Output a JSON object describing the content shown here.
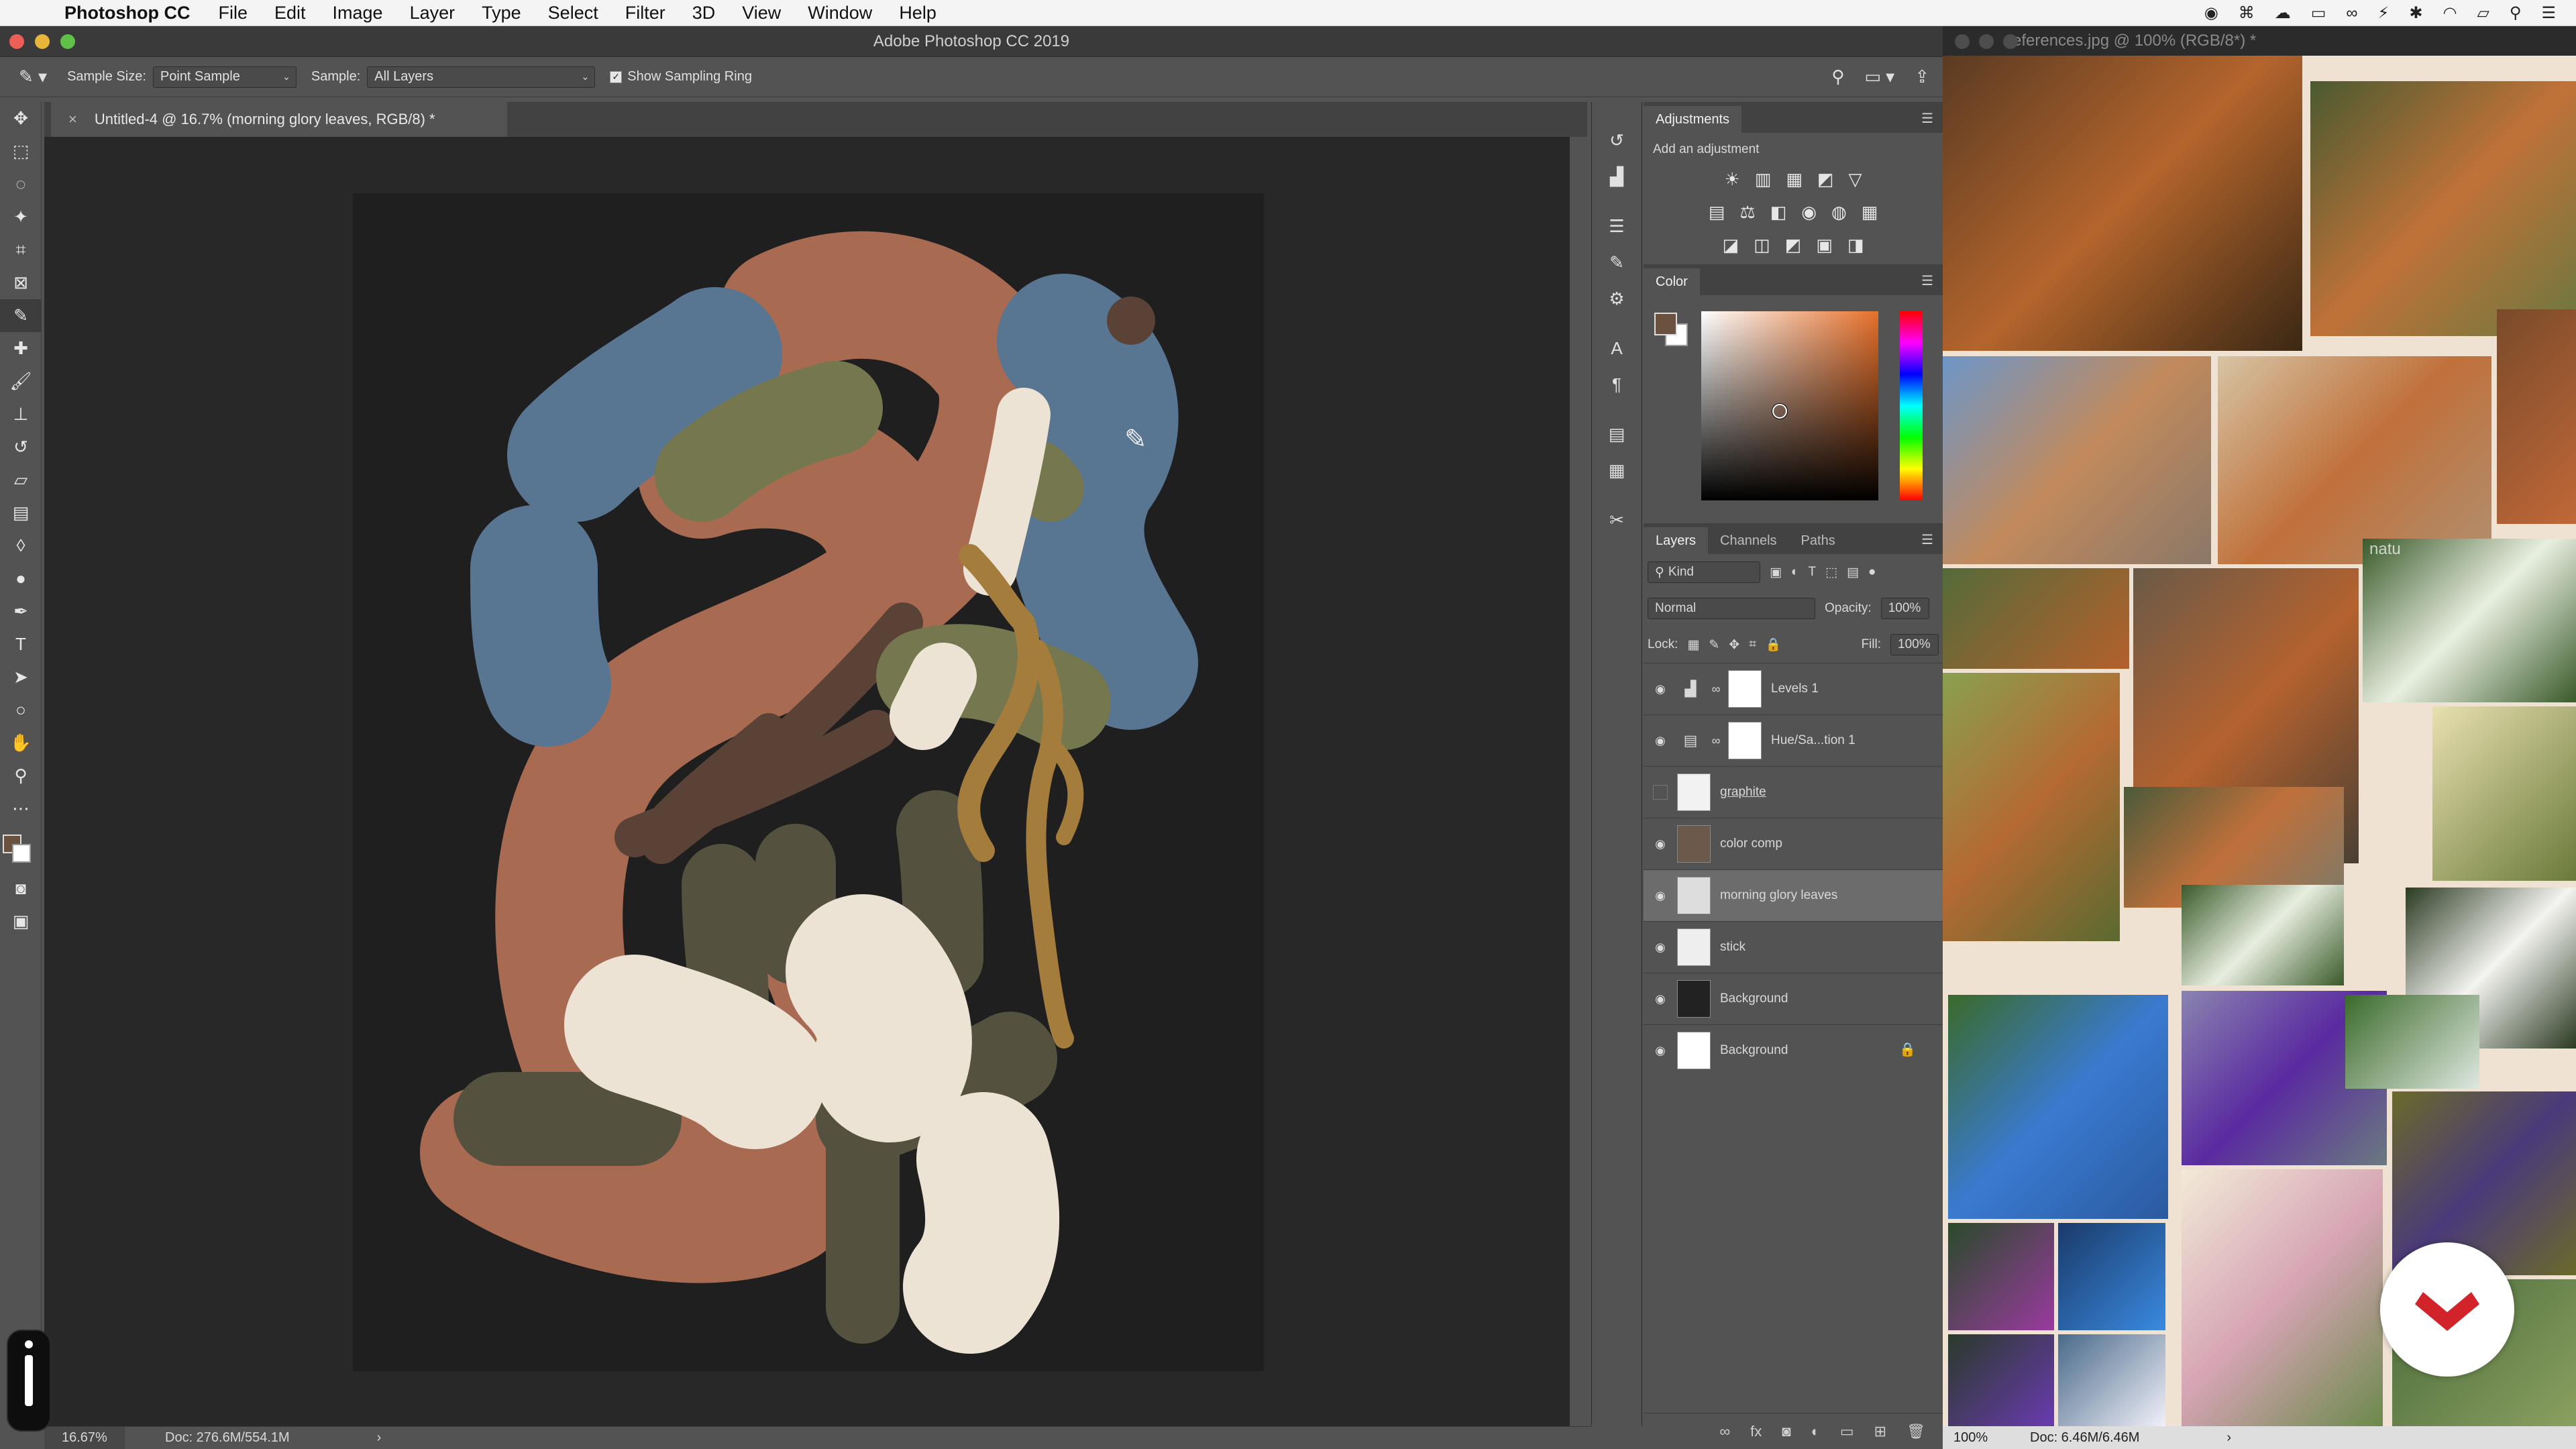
{
  "menubar": {
    "app_name": "Photoshop CC",
    "items": [
      "File",
      "Edit",
      "Image",
      "Layer",
      "Type",
      "Select",
      "Filter",
      "3D",
      "View",
      "Window",
      "Help"
    ]
  },
  "ps_window": {
    "title": "Adobe Photoshop CC 2019"
  },
  "options_bar": {
    "sample_size_label": "Sample Size:",
    "sample_size_value": "Point Sample",
    "sample_label": "Sample:",
    "sample_value": "All Layers",
    "show_ring_label": "Show Sampling Ring",
    "show_ring_checked": true
  },
  "document": {
    "tab_label": "Untitled-4 @ 16.7% (morning glory leaves, RGB/8) *",
    "close_glyph": "×"
  },
  "status_bar": {
    "zoom": "16.67%",
    "doc_size": "Doc: 276.6M/554.1M",
    "arrow": "›"
  },
  "adjustments_panel": {
    "tab": "Adjustments",
    "hint": "Add an adjustment",
    "row1": [
      "☀",
      "▥",
      "▦",
      "◩",
      "▽"
    ],
    "row2": [
      "▤",
      "⚖",
      "◧",
      "◉",
      "◍",
      "▦"
    ],
    "row3": [
      "◪",
      "◫",
      "◩",
      "▣",
      "◨"
    ]
  },
  "color_panel": {
    "tab": "Color",
    "foreground": "#6b5240",
    "background": "#ffffff"
  },
  "layers_panel": {
    "tabs": [
      "Layers",
      "Channels",
      "Paths"
    ],
    "filter_value": "Kind",
    "blend_mode": "Normal",
    "opacity_label": "Opacity:",
    "opacity_value": "100%",
    "lock_label": "Lock:",
    "fill_label": "Fill:",
    "fill_value": "100%",
    "layers": [
      {
        "name": "Levels 1",
        "visible": true,
        "type": "adjustment",
        "icon": "levels-icon"
      },
      {
        "name": "Hue/Sa...tion 1",
        "visible": true,
        "type": "adjustment",
        "icon": "hue-saturation-icon"
      },
      {
        "name": "graphite",
        "visible": false,
        "type": "pixel"
      },
      {
        "name": "color comp",
        "visible": true,
        "type": "pixel"
      },
      {
        "name": "morning glory leaves",
        "visible": true,
        "type": "pixel",
        "selected": true
      },
      {
        "name": "stick",
        "visible": true,
        "type": "pixel"
      },
      {
        "name": "Background",
        "visible": true,
        "type": "pixel",
        "dark": true
      },
      {
        "name": "Background",
        "visible": true,
        "type": "pixel",
        "locked": true
      }
    ]
  },
  "reference_window": {
    "title": "references.jpg @ 100% (RGB/8*) *",
    "zoom": "100%",
    "doc_size": "Doc: 6.46M/6.46M",
    "arrow": "›",
    "watermark_text": "natu"
  },
  "colors": {
    "terracotta": "#a86b52",
    "slate_blue": "#587591",
    "olive": "#75784f",
    "dark_olive": "#55513f",
    "cream": "#ede3d5",
    "ochre": "#a47c3c",
    "dark_brown": "#5a4236",
    "canvas_bg": "#1f1f1f"
  }
}
